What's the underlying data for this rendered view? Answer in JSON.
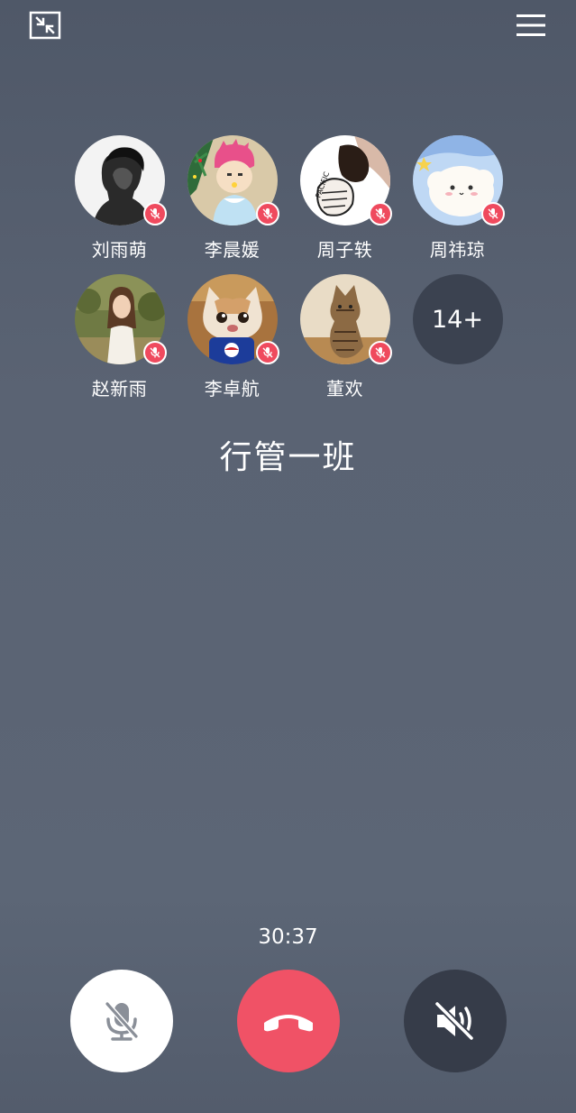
{
  "call": {
    "title": "行管一班",
    "duration": "30:37"
  },
  "participants": [
    {
      "name": "刘雨萌",
      "muted": true,
      "avatar": "man-portrait"
    },
    {
      "name": "李晨媛",
      "muted": true,
      "avatar": "anime-pink-hair"
    },
    {
      "name": "周子轶",
      "muted": true,
      "avatar": "cartoon-sketch"
    },
    {
      "name": "周祎琼",
      "muted": true,
      "avatar": "cute-cloud"
    },
    {
      "name": "赵新雨",
      "muted": true,
      "avatar": "girl-outdoor"
    },
    {
      "name": "李卓航",
      "muted": true,
      "avatar": "cat-pepsi"
    },
    {
      "name": "董欢",
      "muted": true,
      "avatar": "tabby-cat"
    }
  ],
  "more_count": "14+",
  "controls": {
    "mic": "mic-off-icon",
    "hangup": "phone-hangup-icon",
    "speaker": "speaker-off-icon"
  },
  "colors": {
    "mute_badge": "#ef4a5e",
    "hangup": "#f05266",
    "speaker_bg": "#363c49",
    "more_bg": "#3b4250"
  }
}
